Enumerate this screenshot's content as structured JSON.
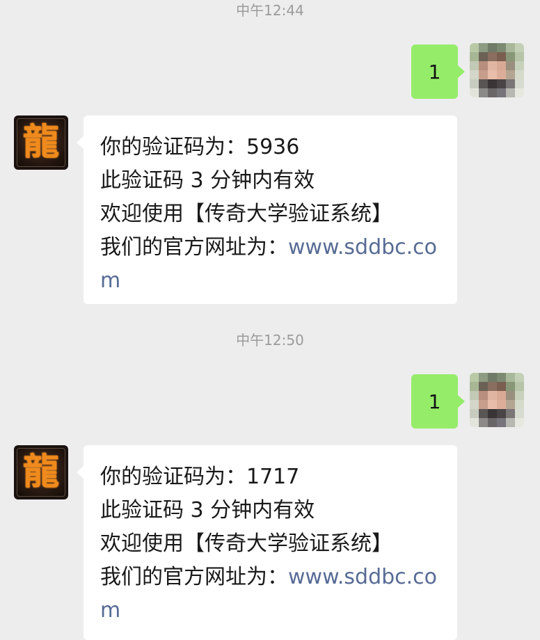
{
  "conversation": {
    "groups": [
      {
        "time": "中午12:44",
        "sent_message": "1",
        "reply": {
          "code_label": "你的验证码为：",
          "code": "5936",
          "validity": "此验证码 3 分钟内有效",
          "welcome": "欢迎使用【传奇大学验证系统】",
          "site_label": "我们的官方网址为：",
          "site_url": "www.sddbc.com"
        }
      },
      {
        "time": "中午12:50",
        "sent_message": "1",
        "reply": {
          "code_label": "你的验证码为：",
          "code": "1717",
          "validity": "此验证码 3 分钟内有效",
          "welcome": "欢迎使用【传奇大学验证系统】",
          "site_label": "我们的官方网址为：",
          "site_url": "www.sddbc.com"
        }
      }
    ]
  },
  "sender_avatar": {
    "glyph": "龍",
    "icon": "dragon-character-logo"
  },
  "colors": {
    "background": "#ededed",
    "self_bubble": "#95ec69",
    "other_bubble": "#ffffff",
    "link": "#576b95",
    "timestamp": "#9b9b9b"
  }
}
